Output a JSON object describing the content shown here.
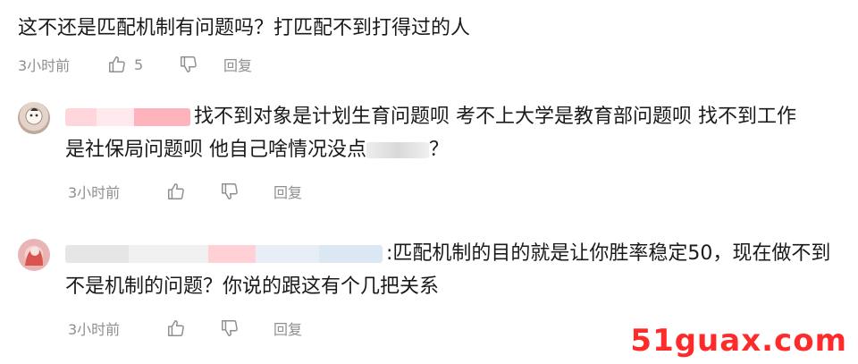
{
  "top_comment": {
    "text": "这不还是匹配机制有问题吗？打匹配不到打得过的人",
    "time": "3小时前",
    "likes": "5",
    "reply_label": "回复"
  },
  "replies": [
    {
      "text_line1": "找不到对象是计划生育问题呗 考不上大学是教育部问题呗 找不到工作",
      "text_line2a": "是社保局问题呗 他自己啥情况没点",
      "text_line2b": "？",
      "time": "3小时前",
      "reply_label": "回复"
    },
    {
      "text_line1": ":匹配机制的目的就是让你胜率稳定50，现在做不到",
      "text_line2": "不是机制的问题？你说的跟这有个几把关系",
      "time": "3小时前",
      "reply_label": "回复"
    }
  ],
  "watermark": "51guax.com",
  "colors": {
    "text": "#1a1a1a",
    "meta": "#8f8f8f",
    "watermark": "#ff2a2a"
  }
}
